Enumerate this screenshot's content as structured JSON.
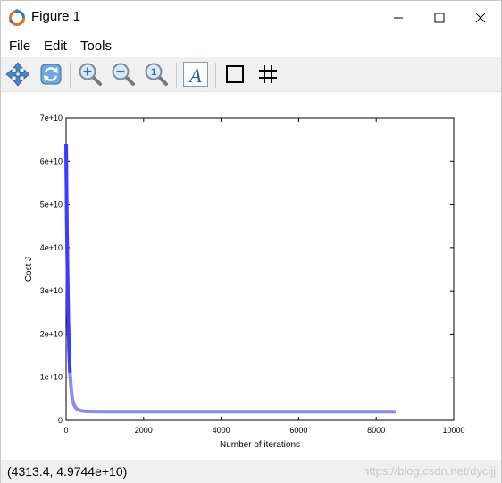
{
  "window": {
    "title": "Figure 1"
  },
  "menu": {
    "file": "File",
    "edit": "Edit",
    "tools": "Tools"
  },
  "toolbar": {
    "tools": [
      "pan-icon",
      "rotate-icon",
      "zoom-in-icon",
      "zoom-out-icon",
      "zoom-reset-icon",
      "text-icon",
      "axes-box-icon",
      "grid-icon"
    ]
  },
  "status": {
    "coords": "(4313.4, 4.9744e+10)",
    "watermark": "https://blog.csdn.net/dycljj"
  },
  "chart_data": {
    "type": "line",
    "xlabel": "Number of iterations",
    "ylabel": "Cost J",
    "xlim": [
      0,
      10000
    ],
    "ylim": [
      0,
      70000000000
    ],
    "xticks": [
      0,
      2000,
      4000,
      6000,
      8000,
      10000
    ],
    "xtick_labels": [
      "0",
      "2000",
      "4000",
      "6000",
      "8000",
      "10000"
    ],
    "yticks": [
      0,
      10000000000,
      20000000000,
      30000000000,
      40000000000,
      50000000000,
      60000000000,
      70000000000
    ],
    "ytick_labels": [
      "0",
      "1e+10",
      "2e+10",
      "3e+10",
      "4e+10",
      "5e+10",
      "6e+10",
      "7e+10"
    ],
    "series": [
      {
        "color": "#3c3cff",
        "x": [
          0,
          20,
          40,
          60,
          80,
          100,
          130,
          160,
          200,
          250,
          300,
          400,
          500,
          700,
          1000,
          2000,
          4000,
          6000,
          8500
        ],
        "values": [
          64000000000,
          45000000000,
          32000000000,
          22000000000,
          15500000000,
          11000000000,
          7500000000,
          5000000000,
          3700000000,
          2900000000,
          2500000000,
          2200000000,
          2100000000,
          2050000000,
          2030000000,
          2020000000,
          2020000000,
          2020000000,
          2020000000
        ]
      }
    ],
    "grid": false
  }
}
